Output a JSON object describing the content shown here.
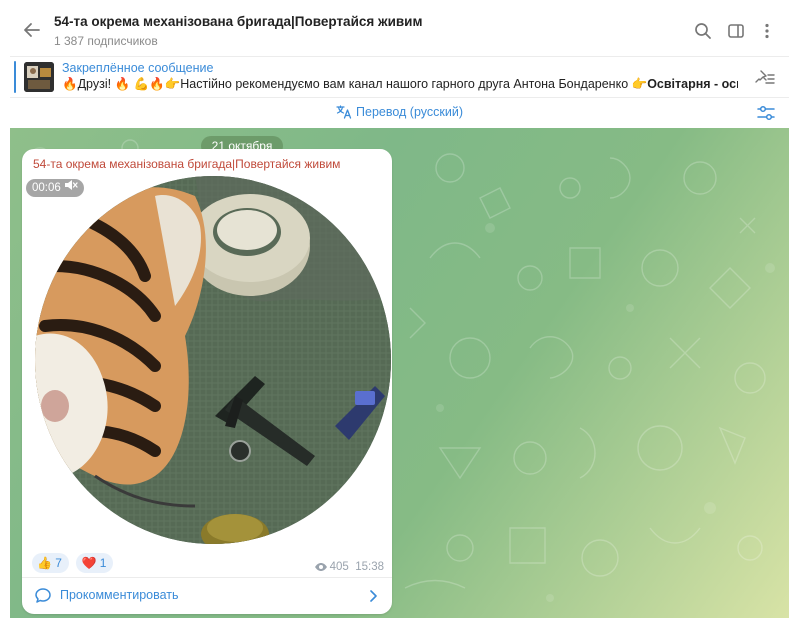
{
  "header": {
    "title": "54-та окрема механізована бригада|Повертайся живим",
    "subscribers": "1 387 подписчиков"
  },
  "pinned": {
    "label": "Закреплённое сообщение",
    "text_prefix": "🔥Друзі! 🔥  💪🔥👉Настійно рекомендуємо вам канал нашого гарного друга Антона Бондаренко  👉",
    "text_bold": "Освітарня - освітн..."
  },
  "translate": {
    "label": "Перевод (русский)"
  },
  "chat": {
    "date": "21 октября",
    "message": {
      "channel_name": "54-та окрема механізована бригада|Повертайся живим",
      "duration": "00:06",
      "reactions": [
        {
          "emoji": "👍",
          "count": "7"
        },
        {
          "emoji": "❤️",
          "count": "1"
        }
      ],
      "views": "405",
      "time": "15:38",
      "comment_label": "Прокомментировать"
    }
  }
}
